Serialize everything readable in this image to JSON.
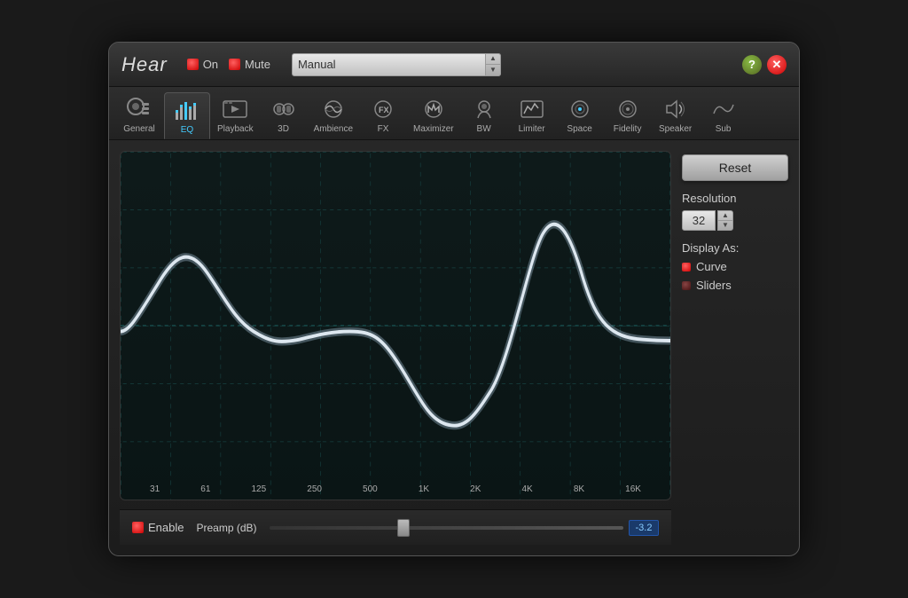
{
  "app": {
    "title": "Hear",
    "header": {
      "on_label": "On",
      "mute_label": "Mute",
      "preset_value": "Manual",
      "preset_placeholder": "Manual"
    },
    "tabs": [
      {
        "id": "general",
        "label": "General",
        "icon": "🎧",
        "active": false
      },
      {
        "id": "eq",
        "label": "EQ",
        "icon": "📊",
        "active": true
      },
      {
        "id": "playback",
        "label": "Playback",
        "icon": "⏯",
        "active": false
      },
      {
        "id": "3d",
        "label": "3D",
        "icon": "🔊",
        "active": false
      },
      {
        "id": "ambience",
        "label": "Ambience",
        "icon": "🌊",
        "active": false
      },
      {
        "id": "fx",
        "label": "FX",
        "icon": "🎵",
        "active": false
      },
      {
        "id": "maximizer",
        "label": "Maximizer",
        "icon": "🎛",
        "active": false
      },
      {
        "id": "bw",
        "label": "BW",
        "icon": "👤",
        "active": false
      },
      {
        "id": "limiter",
        "label": "Limiter",
        "icon": "📈",
        "active": false
      },
      {
        "id": "space",
        "label": "Space",
        "icon": "🔵",
        "active": false
      },
      {
        "id": "fidelity",
        "label": "Fidelity",
        "icon": "💿",
        "active": false
      },
      {
        "id": "speaker",
        "label": "Speaker",
        "icon": "〰",
        "active": false
      },
      {
        "id": "sub",
        "label": "Sub",
        "icon": "〰",
        "active": false
      }
    ],
    "eq": {
      "freq_labels": [
        "31",
        "61",
        "125",
        "250",
        "500",
        "1K",
        "2K",
        "4K",
        "8K",
        "16K"
      ],
      "enable_label": "Enable",
      "preamp_label": "Preamp (dB)",
      "preamp_value": "-3.2",
      "resolution_label": "Resolution",
      "resolution_value": "32",
      "display_as_label": "Display As:",
      "display_curve_label": "Curve",
      "display_sliders_label": "Sliders",
      "reset_label": "Reset"
    }
  }
}
